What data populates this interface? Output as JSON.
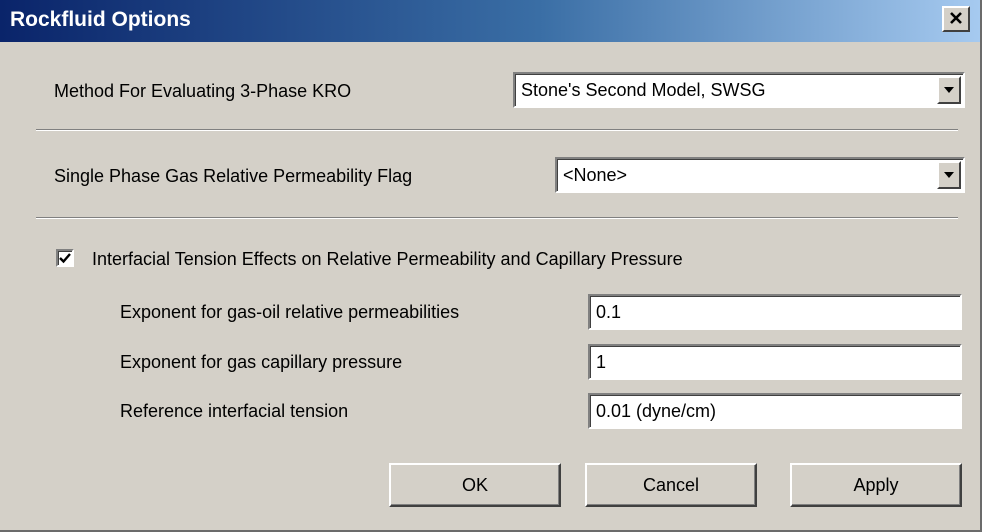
{
  "window": {
    "title": "Rockfluid Options",
    "close_glyph": "✕",
    "close_icon": "close-icon"
  },
  "kro_method": {
    "label": "Method For Evaluating 3-Phase KRO",
    "value": "Stone's Second Model, SWSG"
  },
  "gas_flag": {
    "label": "Single Phase Gas Relative Permeability Flag",
    "value": "<None>"
  },
  "ift": {
    "checkbox_label": "Interfacial Tension Effects on Relative Permeability and Capillary Pressure",
    "checked": true,
    "fields": [
      {
        "label": "Exponent for gas-oil relative permeabilities",
        "value": "0.1"
      },
      {
        "label": "Exponent for gas capillary pressure",
        "value": "1"
      },
      {
        "label": "Reference interfacial tension",
        "value": "0.01  (dyne/cm)"
      }
    ]
  },
  "buttons": {
    "ok": "OK",
    "cancel": "Cancel",
    "apply": "Apply"
  }
}
